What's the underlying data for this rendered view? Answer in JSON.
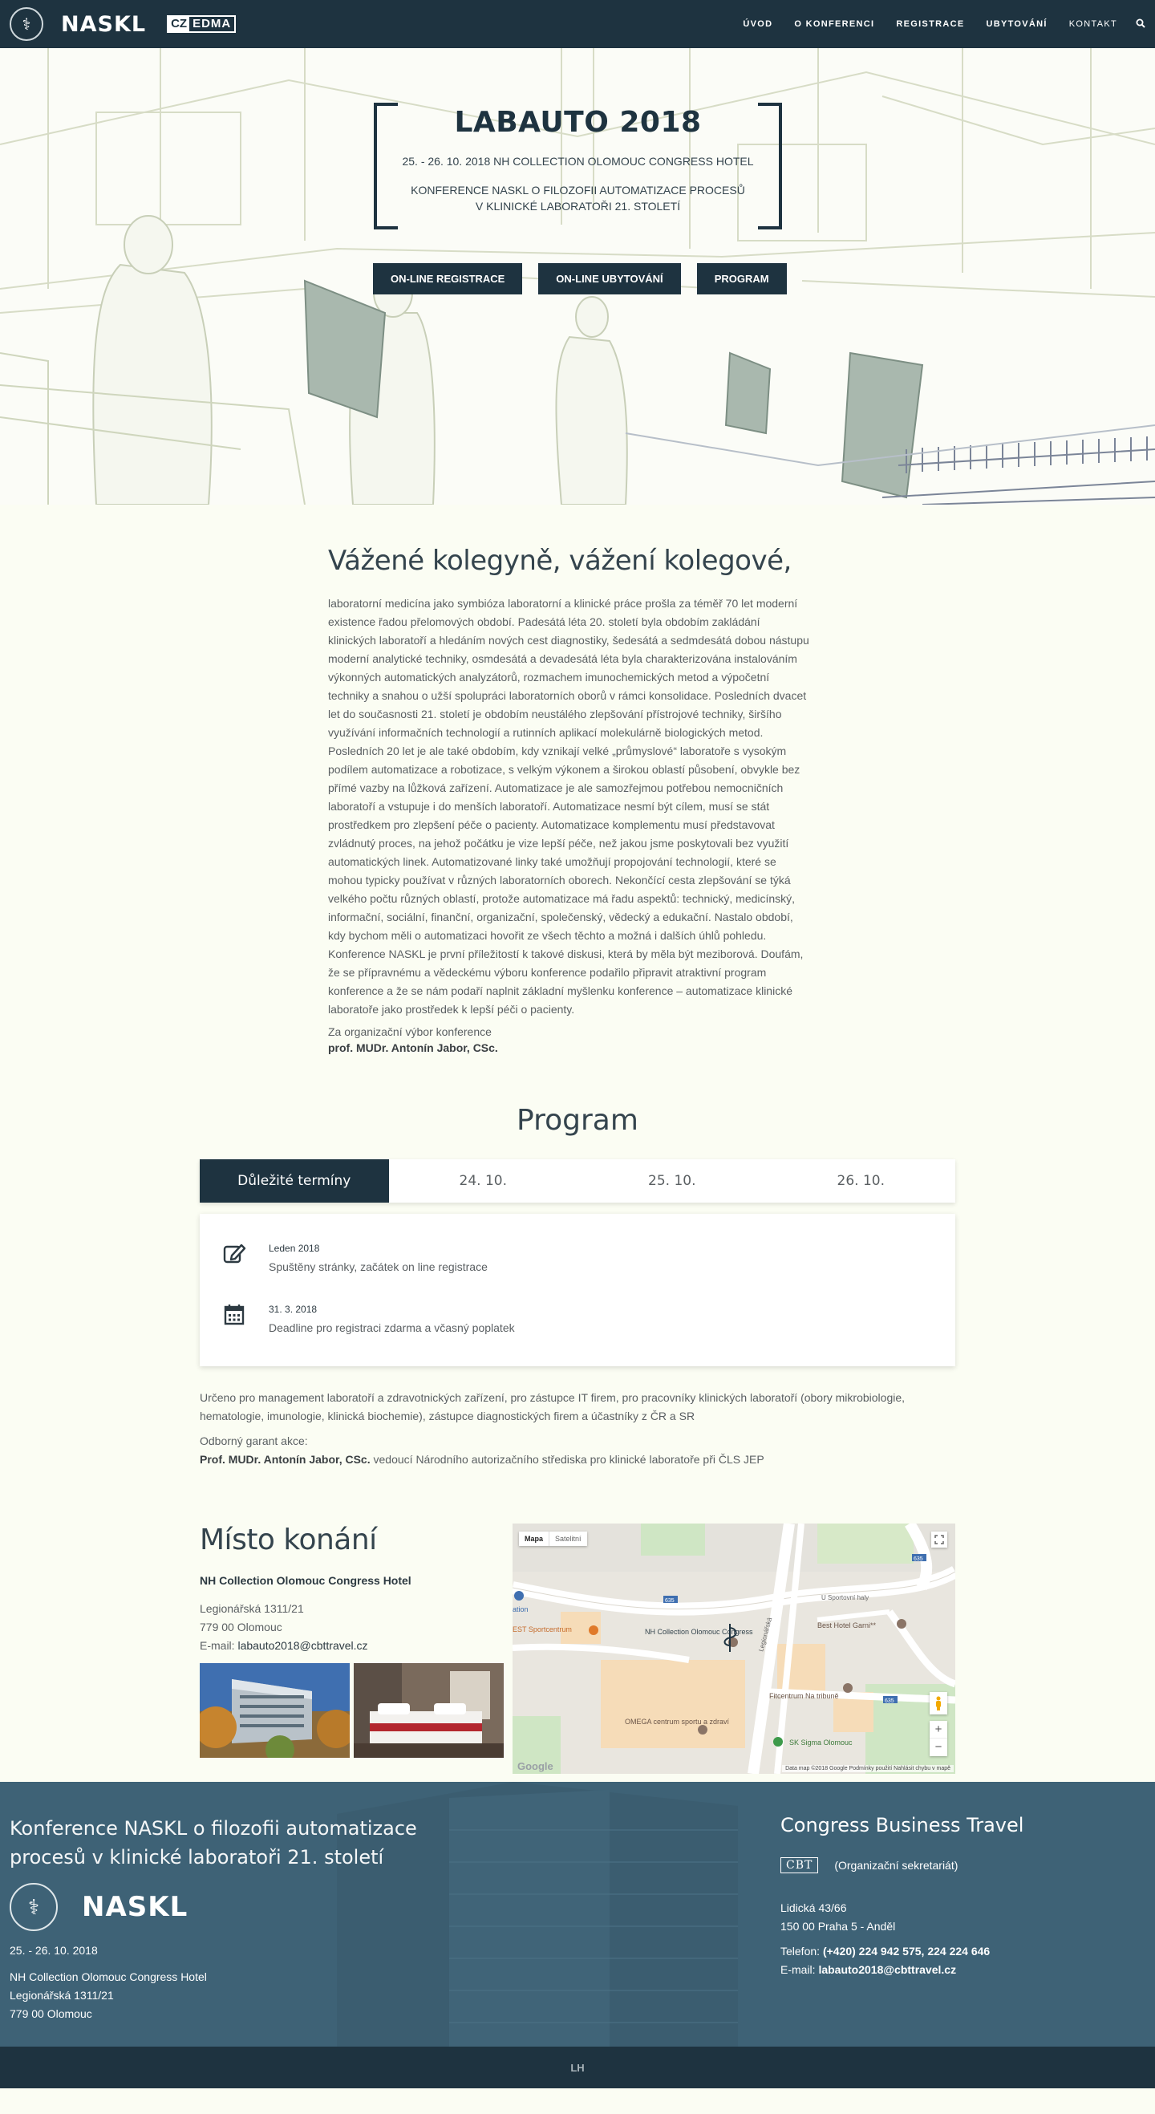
{
  "nav": {
    "logo_text": "NASKL",
    "partner_cz": "CZ",
    "partner_edma": "EDMA",
    "menu": [
      "ÚVOD",
      "O KONFERENCI",
      "REGISTRACE",
      "UBYTOVÁNÍ",
      "KONTAKT"
    ],
    "search_icon": "search-icon"
  },
  "hero": {
    "title": "LABAUTO 2018",
    "date": "25. - 26. 10. 2018 NH COLLECTION OLOMOUC CONGRESS HOTEL",
    "subtitle_line1": "KONFERENCE NASKL O FILOZOFII AUTOMATIZACE PROCESŮ",
    "subtitle_line2": "V KLINICKÉ LABORATOŘI 21. STOLETÍ",
    "buttons": [
      "ON-LINE REGISTRACE",
      "ON-LINE UBYTOVÁNÍ",
      "PROGRAM"
    ]
  },
  "intro": {
    "heading": "Vážené kolegyně, vážení kolegové,",
    "body": "laboratorní medicína jako symbióza laboratorní a klinické práce prošla za téměř 70 let moderní existence řadou přelomových období. Padesátá léta 20. století byla obdobím zakládání klinických laboratoří a hledáním nových cest diagnostiky, šedesátá a sedmdesátá dobou nástupu moderní analytické techniky, osmdesátá a devadesátá léta byla charakterizována instalováním výkonných automatických analyzátorů, rozmachem imunochemických metod a výpočetní techniky a snahou o užší spolupráci laboratorních oborů v rámci konsolidace. Posledních dvacet let do současnosti 21. století je obdobím neustálého zlepšování přístrojové techniky, širšího využívání informačních technologií a rutinních aplikací molekulárně biologických metod. Posledních 20 let je ale také obdobím, kdy vznikají velké „průmyslové“ laboratoře s vysokým podílem automatizace a robotizace, s velkým výkonem a širokou oblastí působení, obvykle bez přímé vazby na lůžková zařízení. Automatizace je ale samozřejmou potřebou nemocničních laboratoří a vstupuje i do menších laboratoří. Automatizace nesmí být cílem, musí se stát prostředkem pro zlepšení péče o pacienty. Automatizace komplementu musí představovat zvládnutý proces, na jehož počátku je vize lepší péče, než jakou jsme poskytovali bez využití automatických linek. Automatizované linky také umožňují propojování technologií, které se mohou typicky používat v různých laboratorních oborech. Nekončící cesta zlepšování se týká velkého počtu různých oblastí, protože automatizace má řadu aspektů: technický, medicínský, informační, sociální, finanční, organizační, společenský, vědecký a edukační. Nastalo období, kdy bychom měli o automatizaci hovořit ze všech těchto a možná i dalších úhlů pohledu. Konference NASKL je první příležitostí k takové diskusi, která by měla být meziborová. Doufám, že se přípravnému a vědeckému výboru konference podařilo připravit atraktivní program konference a že se nám podaří naplnit základní myšlenku konference – automatizace klinické laboratoře jako prostředek k lepší péči o pacienty.",
    "sign_line": "Za organizační výbor konference",
    "sign_name": "prof. MUDr. Antonín Jabor, CSc."
  },
  "program": {
    "title": "Program",
    "tabs": [
      "Důležité termíny",
      "24. 10.",
      "25. 10.",
      "26. 10."
    ],
    "events": [
      {
        "date": "Leden 2018",
        "text": "Spuštěny stránky, začátek on line registrace",
        "icon": "edit-icon"
      },
      {
        "date": "31. 3. 2018",
        "text": "Deadline pro registraci zdarma a včasný poplatek",
        "icon": "calendar-icon"
      }
    ],
    "note": "Určeno pro management laboratoří a zdravotnických zařízení, pro zástupce IT firem, pro pracovníky klinických laboratoří (obory mikrobiologie, hematologie, imunologie, klinická biochemie), zástupce diagnostických firem a účastníky z ČR a SR",
    "guarant_label": "Odborný garant akce:",
    "guarant_name": "Prof. MUDr. Antonín Jabor, CSc.",
    "guarant_role": "vedoucí Národního autorizačního střediska pro klinické laboratoře při ČLS JEP"
  },
  "venue": {
    "title": "Místo konání",
    "hotel": "NH Collection Olomouc Congress Hotel",
    "street": "Legionářská 1311/21",
    "city": "779 00 Olomouc",
    "email_label": "E-mail:",
    "email": "labauto2018@cbttravel.cz",
    "map": {
      "tab_map": "Mapa",
      "tab_sat": "Satelitní",
      "labels": [
        "NH Collection Olomouc Congress",
        "EST Sportcentrum",
        "Best Hotel Garni**",
        "Fitcentrum Na tribuně",
        "OMEGA centrum sportu a zdraví",
        "SK Sigma Olomouc",
        "U Sportovní haly",
        "Legionářská",
        "ation"
      ],
      "road_badges": [
        "635",
        "635",
        "635"
      ],
      "footer_text": "Data map ©2018 Google   Podmínky použití   Nahlásit chybu v mapě",
      "google": "Google",
      "zoom_in": "+",
      "zoom_out": "−"
    }
  },
  "footer": {
    "title": "Konference NASKL o filozofii automatizace procesů v klinické laboratoři 21. století",
    "logo_text": "NASKL",
    "date": "25. - 26. 10. 2018",
    "hotel": "NH Collection Olomouc Congress Hotel",
    "street": "Legionářská 1311/21",
    "city": "779 00 Olomouc",
    "cbt_title": "Congress Business Travel",
    "cbt_logo": "CBT",
    "org_note": "(Organizační sekretariát)",
    "cbt_street": "Lidická 43/66",
    "cbt_city": "150 00 Praha 5 - Anděl",
    "phone_label": "Telefon:",
    "phone": "(+420) 224 942 575, 224 224 646",
    "email_label": "E-mail:",
    "email": "labauto2018@cbttravel.cz",
    "bottom_mark": "LH"
  },
  "colors": {
    "navy": "#1e3340",
    "footer": "#3e6276",
    "page_bg": "#fbfdf3"
  }
}
